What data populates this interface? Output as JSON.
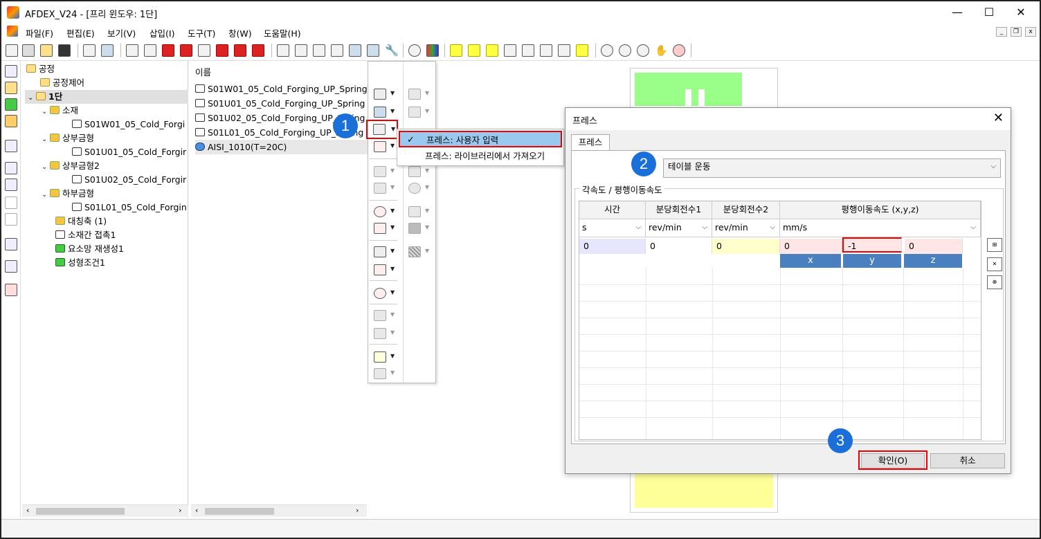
{
  "window": {
    "title": "AFDEX_V24 - [프리 윈도우: 1단]",
    "minimize": "—",
    "maximize": "☐",
    "close": "✕"
  },
  "menu": [
    "파일(F)",
    "편집(E)",
    "보기(V)",
    "삽입(I)",
    "도구(T)",
    "창(W)",
    "도움말(H)"
  ],
  "tree": {
    "items": [
      {
        "label": "공정",
        "icon": "folder-open-icon"
      },
      {
        "label": "공정제어",
        "icon": "folder-icon"
      },
      {
        "label": "1단",
        "icon": "folder-open-icon"
      },
      {
        "label": "소재",
        "icon": "material-icon"
      },
      {
        "label": "S01W01_05_Cold_Forgi",
        "icon": "part-icon"
      },
      {
        "label": "상부금형",
        "icon": "upper-die-icon"
      },
      {
        "label": "S01U01_05_Cold_Forgir",
        "icon": "part-icon"
      },
      {
        "label": "상부금형2",
        "icon": "upper-die-icon"
      },
      {
        "label": "S01U02_05_Cold_Forgir",
        "icon": "part-icon"
      },
      {
        "label": "하부금형",
        "icon": "lower-die-icon"
      },
      {
        "label": "S01L01_05_Cold_Forgin",
        "icon": "part-icon"
      },
      {
        "label": "대칭축 (1)",
        "icon": "symmetry-icon"
      },
      {
        "label": "소재간 접촉1",
        "icon": "contact-icon"
      },
      {
        "label": "요소망 재생성1",
        "icon": "remesh-icon"
      },
      {
        "label": "성형조건1",
        "icon": "condition-icon"
      }
    ]
  },
  "names": {
    "header": "이름",
    "rows": [
      "S01W01_05_Cold_Forging_UP_Spring",
      "S01U01_05_Cold_Forging_UP_Spring",
      "S01U02_05_Cold_Forging_UP_Spring",
      "S01L01_05_Cold_Forging_UP_Spring",
      "AISI_1010(T=20C)"
    ]
  },
  "context_menu": {
    "items": [
      "프레스: 사용자 입력",
      "프레스: 라이브러리에서 가져오기"
    ]
  },
  "badges": [
    "1",
    "2",
    "3"
  ],
  "dialog": {
    "title": "프레스",
    "tab": "프레스",
    "motion_type": "테이블 운동",
    "group_label": "각속도 / 평행이동속도",
    "columns": [
      "시간",
      "분당회전수1",
      "분당회전수2",
      "평행이동속도 (x,y,z)"
    ],
    "units": [
      "s",
      "rev/min",
      "rev/min",
      "mm/s"
    ],
    "row": [
      "0",
      "0",
      "0",
      "0",
      "-1",
      "0"
    ],
    "axis_buttons": [
      "x",
      "y",
      "z"
    ],
    "ok": "확인(O)",
    "cancel": "취소"
  },
  "colors": {
    "accent": "#1a6fd9",
    "highlight_red": "#e00000",
    "menu_highlight": "#99c9ef",
    "axis_button": "#4a7fc0",
    "cell_time": "#e6e6ff",
    "cell_rpm2": "#ffffcc",
    "cell_translation": "#ffe6e6",
    "canvas_green": "#99ff88",
    "canvas_yellow": "#ffff99"
  }
}
